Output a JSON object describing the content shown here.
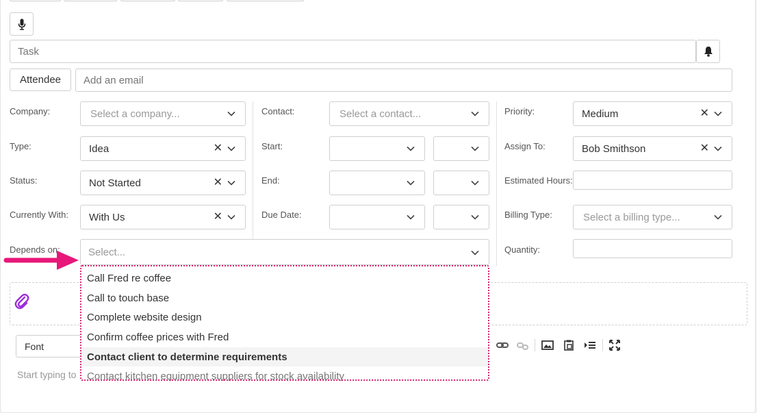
{
  "task": {
    "placeholder": "Task"
  },
  "attendee": {
    "button_label": "Attendee",
    "email_placeholder": "Add an email"
  },
  "fields": {
    "company": {
      "label": "Company:",
      "placeholder": "Select a company..."
    },
    "contact": {
      "label": "Contact:",
      "placeholder": "Select a contact..."
    },
    "priority": {
      "label": "Priority:",
      "value": "Medium"
    },
    "type": {
      "label": "Type:",
      "value": "Idea"
    },
    "start": {
      "label": "Start:"
    },
    "assign_to": {
      "label": "Assign To:",
      "value": "Bob Smithson"
    },
    "status": {
      "label": "Status:",
      "value": "Not Started"
    },
    "end": {
      "label": "End:"
    },
    "estimated_hours": {
      "label": "Estimated Hours:"
    },
    "currently_with": {
      "label": "Currently With:",
      "value": "With Us"
    },
    "due_date": {
      "label": "Due Date:"
    },
    "billing_type": {
      "label": "Billing Type:",
      "placeholder": "Select a billing type..."
    },
    "depends_on": {
      "label": "Depends on:",
      "placeholder": "Select..."
    },
    "quantity": {
      "label": "Quantity:"
    }
  },
  "depends_on_options": [
    "Call Fred re coffee",
    "Call to touch base",
    "Complete website design",
    "Confirm coffee prices with Fred",
    "Contact client to determine requirements",
    "Contact kitchen equipment suppliers for stock availability"
  ],
  "editor": {
    "font_label": "Font",
    "placeholder": "Start typing to"
  },
  "colors": {
    "annotation": "#e8177a",
    "dropdown_border": "#d6246e",
    "attach_icon": "#9b30d9"
  },
  "icons": [
    "microphone-icon",
    "bell-icon",
    "clear-x-icon",
    "chevron-down-icon",
    "paperclip-icon",
    "link-icon",
    "unlink-icon",
    "image-icon",
    "paste-icon",
    "indent-icon",
    "fullscreen-icon"
  ]
}
